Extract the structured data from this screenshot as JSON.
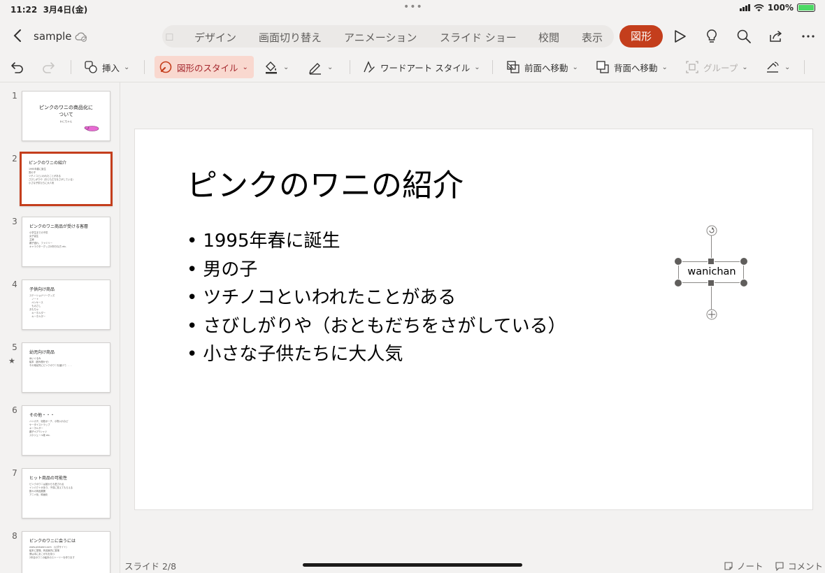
{
  "status": {
    "time": "11:22",
    "date": "3月4日(金)",
    "dots": "•••",
    "battery": "100%"
  },
  "titlebar": {
    "doc_name": "sample",
    "tabs": [
      "デザイン",
      "画面切り替え",
      "アニメーション",
      "スライド ショー",
      "校閲",
      "表示"
    ],
    "active_tab": "図形",
    "icons": [
      "play-icon",
      "lightbulb-icon",
      "search-icon",
      "share-icon",
      "more-icon"
    ]
  },
  "ribbon": {
    "insert": "挿入",
    "shape_style": "図形のスタイル",
    "wordart_style": "ワードアート スタイル",
    "bring_forward": "前面へ移動",
    "send_backward": "背面へ移動",
    "group": "グループ",
    "chevron": "⌄",
    "accent": "#c43e1c"
  },
  "thumbnails": [
    {
      "num": "1",
      "title": "ピンクのワニの商品化に\nついて",
      "subtitle": "わにちゃん",
      "bullets": []
    },
    {
      "num": "2",
      "title": "ピンクのワニの紹介",
      "bullets": [
        "1995年春に誕生",
        "男の子",
        "ツチノコといわれたことがある",
        "さびしがりや（おともだちをさがしている）",
        "小さな子供たちに大人気"
      ],
      "selected": true
    },
    {
      "num": "3",
      "title": "ピンクのワニ商品が受ける客層",
      "bullets": [
        "小学生までの子供",
        "女子高生",
        "主婦",
        "親子連れ、ファミリー",
        "キャラクターグッズが好きな方 etc."
      ]
    },
    {
      "num": "4",
      "title": "子供向け商品",
      "bullets": [
        "ステーショナリーグッズ",
        "　ノート",
        "　ペンケース",
        "　ものさし",
        "おもちゃ",
        "　キーホルダー",
        "　キーホルダー"
      ]
    },
    {
      "num": "5",
      "title": "幼児向け商品",
      "bullets": [
        "ぬいぐるみ",
        "絵本（読み聞かせ）",
        "その他幼児にピンクのワニを届けて．．．"
      ]
    },
    {
      "num": "6",
      "title": "その他・・・",
      "bullets": [
        "ハンカチ、化粧ポーチ、小物入れなど",
        "ケータイストラップ",
        "キーホルダー",
        "親子ペアTシャツ",
        "スケジュール帳 etc."
      ]
    },
    {
      "num": "7",
      "title": "ヒット商品の可能性",
      "bullets": [
        "ピンクのワニは誰からも愛される",
        "インパクトがあり、子供に覚えてもらえる",
        "数々の商品展開",
        "アニメ化、映画化"
      ]
    },
    {
      "num": "8",
      "title": "ピンクのワニに会うには",
      "bullets": [
        "www.pinkwani.com （公式サイト）",
        "絵本に登場、商品案内に登場",
        "夢は本にあこがれを持つ",
        "2年目のワニの絵本のストーリーを作ります"
      ]
    }
  ],
  "slide": {
    "title": "ピンクのワニの紹介",
    "bullets": [
      "1995年春に誕生",
      "男の子",
      "ツチノコといわれたことがある",
      "さびしがりや（おともだちをさがしている）",
      "小さな子供たちに大人気"
    ],
    "shape_text": "wanichan"
  },
  "footer": {
    "slide_counter": "スライド 2/8",
    "notes": "ノート",
    "comments": "コメント"
  }
}
